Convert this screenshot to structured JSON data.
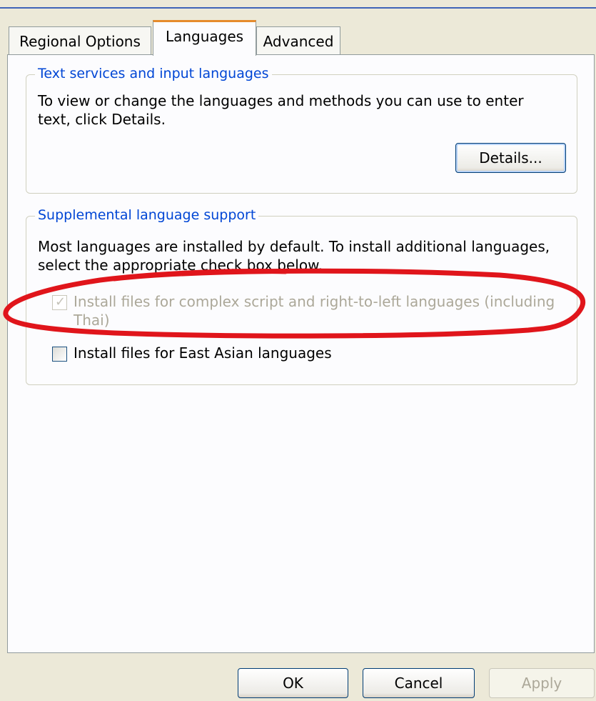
{
  "tabs": [
    {
      "label": "Regional Options",
      "active": false
    },
    {
      "label": "Languages",
      "active": true
    },
    {
      "label": "Advanced",
      "active": false
    }
  ],
  "text_services": {
    "title": "Text services and input languages",
    "description_line1": "To view or change the languages and methods you can use to enter",
    "description_line2": "text, click Details.",
    "details_button": "Details..."
  },
  "supplemental": {
    "title": "Supplemental language support",
    "description_line1": "Most languages are installed by default. To install additional languages,",
    "description_line2": "select the appropriate check box below.",
    "complex_script": {
      "label_line1": "Install files for complex script and right-to-left languages (including",
      "label_line2": "Thai)",
      "checked": true,
      "enabled": false
    },
    "east_asian": {
      "label": "Install files for East Asian languages",
      "checked": false,
      "enabled": true
    }
  },
  "footer": {
    "ok": "OK",
    "cancel": "Cancel",
    "apply": "Apply"
  },
  "colors": {
    "annotation": "#e0151b",
    "group_title": "#0046d5",
    "active_tab_accent": "#e68b2c"
  }
}
